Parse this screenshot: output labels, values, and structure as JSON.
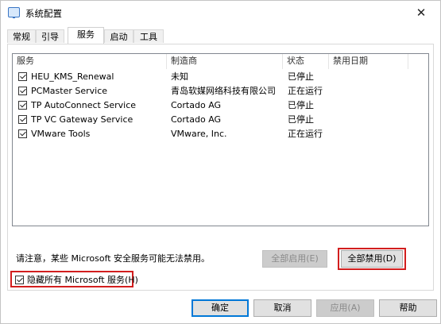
{
  "window": {
    "title": "系统配置",
    "close_glyph": "✕"
  },
  "tabs": [
    {
      "label": "常规"
    },
    {
      "label": "引导"
    },
    {
      "label": "服务"
    },
    {
      "label": "启动"
    },
    {
      "label": "工具"
    }
  ],
  "services_table": {
    "columns": [
      "服务",
      "制造商",
      "状态",
      "禁用日期"
    ],
    "rows": [
      {
        "name": "HEU_KMS_Renewal",
        "vendor": "未知",
        "status": "已停止",
        "checked": true
      },
      {
        "name": "PCMaster Service",
        "vendor": "青岛软媒网络科技有限公司",
        "status": "正在运行",
        "checked": true
      },
      {
        "name": "TP AutoConnect Service",
        "vendor": "Cortado AG",
        "status": "已停止",
        "checked": true
      },
      {
        "name": "TP VC Gateway Service",
        "vendor": "Cortado AG",
        "status": "已停止",
        "checked": true
      },
      {
        "name": "VMware Tools",
        "vendor": "VMware, Inc.",
        "status": "正在运行",
        "checked": true
      }
    ]
  },
  "note": "请注意，某些 Microsoft 安全服务可能无法禁用。",
  "buttons": {
    "enable_all": "全部启用(E)",
    "disable_all": "全部禁用(D)",
    "ok": "确定",
    "cancel": "取消",
    "apply": "应用(A)",
    "help": "帮助"
  },
  "hide_microsoft": {
    "label": "隐藏所有 Microsoft 服务(H)",
    "checked": true
  },
  "colors": {
    "highlight_red": "#d21e1e",
    "default_button_blue": "#0078d7"
  }
}
